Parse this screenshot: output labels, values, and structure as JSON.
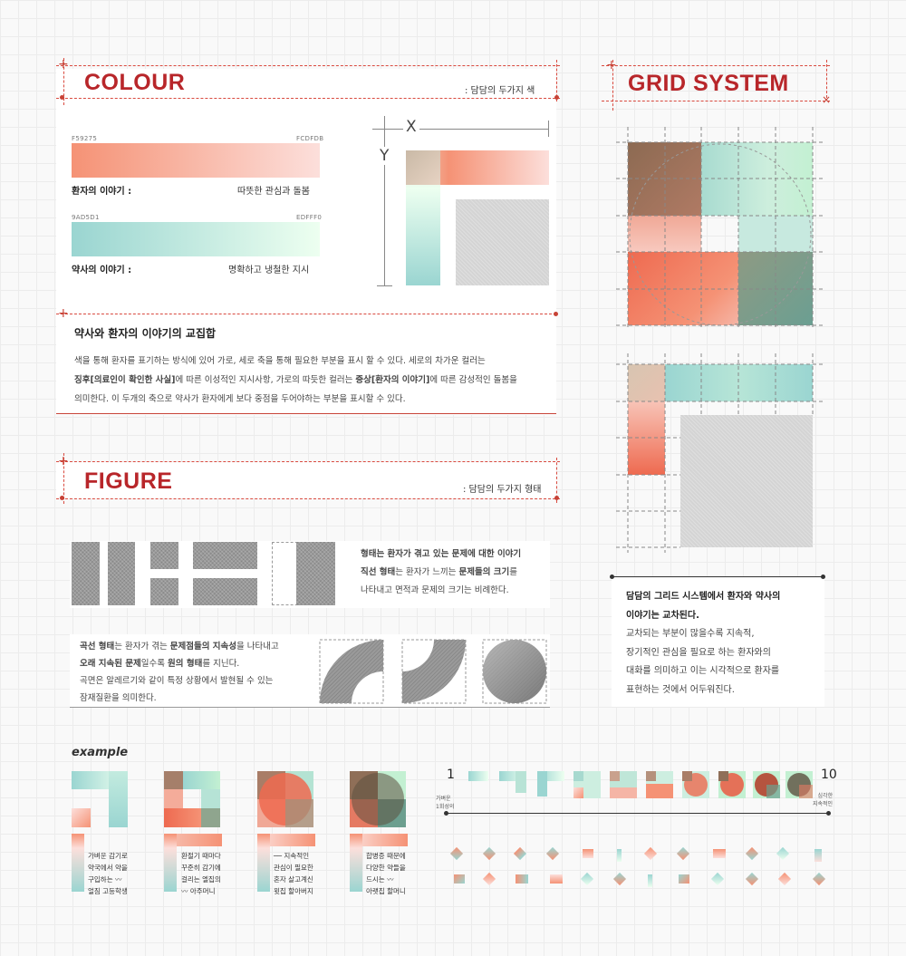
{
  "colour": {
    "title": "COLOUR",
    "subtitle": ": 담담의 두가지 색",
    "coral": {
      "hex_start": "F59275",
      "hex_end": "FCDFDB",
      "label": "환자의 이야기 :",
      "desc": "따뜻한 관심과 돌봄"
    },
    "mint": {
      "hex_start": "9AD5D1",
      "hex_end": "EDFFF0",
      "label": "약사의 이야기 :",
      "desc": "명확하고 냉철한 지시"
    },
    "axis_x": "X",
    "axis_y": "Y"
  },
  "intersection": {
    "heading": "약사와 환자의 이야기의 교집합",
    "p1": "색을 통해 환자를 표기하는 방식에 있어 가로, 세로 축을 통해 필요한 부분을 표시 할 수 있다. 세로의 차가운 컬러는",
    "p2a": "징후[의료인이 확인한 사실]",
    "p2b": "에 따른 이성적인 지시사항, 가로의 따듯한 컬러는 ",
    "p2c": "증상[환자의 이야기]",
    "p2d": "에 따른 감성적인 돌봄을",
    "p3": "의미한다. 이 두개의 축으로 약사가 환자에게 보다 중점을 두어야하는 부분을 표시할 수 있다."
  },
  "figure": {
    "title": "FIGURE",
    "subtitle": ": 담담의 두가지 형태",
    "straight_b1": "형태는 환자가 겪고 있는 문제에 대한 이야기",
    "straight_b2": "직선 형태",
    "straight_t1": "는 환자가 느끼는 ",
    "straight_b3": "문제들의 크기",
    "straight_t2": "를",
    "straight_t3": "나타내고 면적과 문제의 크기는 비례한다.",
    "curve_b1": "곡선 형태",
    "curve_t1": "는 환자가 겪는 ",
    "curve_b2": "문제점들의 지속성",
    "curve_t2": "을 나타내고",
    "curve_b3": "오래 지속된 문제",
    "curve_t3": "일수록 ",
    "curve_b4": "원의 형태",
    "curve_t4": "를 지닌다.",
    "curve_t5": "곡면은 알레르기와 같이 특정 상황에서 발현될 수 있는",
    "curve_t6": "잠재질환을 의미한다."
  },
  "grid": {
    "title": "GRID SYSTEM",
    "desc_b1": "담담의 그리드 시스템에서 환자와 약사의",
    "desc_b2": "이야기는 교차된다.",
    "desc_l1": "교차되는 부분이 많을수록 지속적,",
    "desc_l2": "장기적인 관심을 필요로 하는 환자와의",
    "desc_l3": "대화를 의미하고 이는 시각적으로 환자를",
    "desc_l4": "표현하는 것에서 어두워진다."
  },
  "example": {
    "title": "example",
    "items": [
      {
        "l1": "가벼운 감기로",
        "l2": "약국에서 약을",
        "l3": "구입하는 〰",
        "l4": "얼짐 고등학생"
      },
      {
        "l1": "환절기 때마다",
        "l2": "꾸준히 감기에",
        "l3": "걸리는 엘집의",
        "l4": "〰 아주머니"
      },
      {
        "l1": "── 지속적인",
        "l2": "관심이 필요한",
        "l3": "혼자 살고계신",
        "l4": "윗집 할아버지"
      },
      {
        "l1": "합병증 때문에",
        "l2": "다양한 약들을",
        "l3": "드시는 〰",
        "l4": "아랫집 할머니"
      }
    ],
    "scale_start": "1",
    "scale_end": "10",
    "scale_left_l1": "가벼운",
    "scale_left_l2": "1회성의",
    "scale_right_l1": "심각한",
    "scale_right_l2": "지속적인"
  },
  "colors": {
    "accent": "#b8262a",
    "coral": "#f59275",
    "coral_light": "#fcdfdb",
    "mint": "#9ad5d1",
    "mint_light": "#edfff0"
  }
}
